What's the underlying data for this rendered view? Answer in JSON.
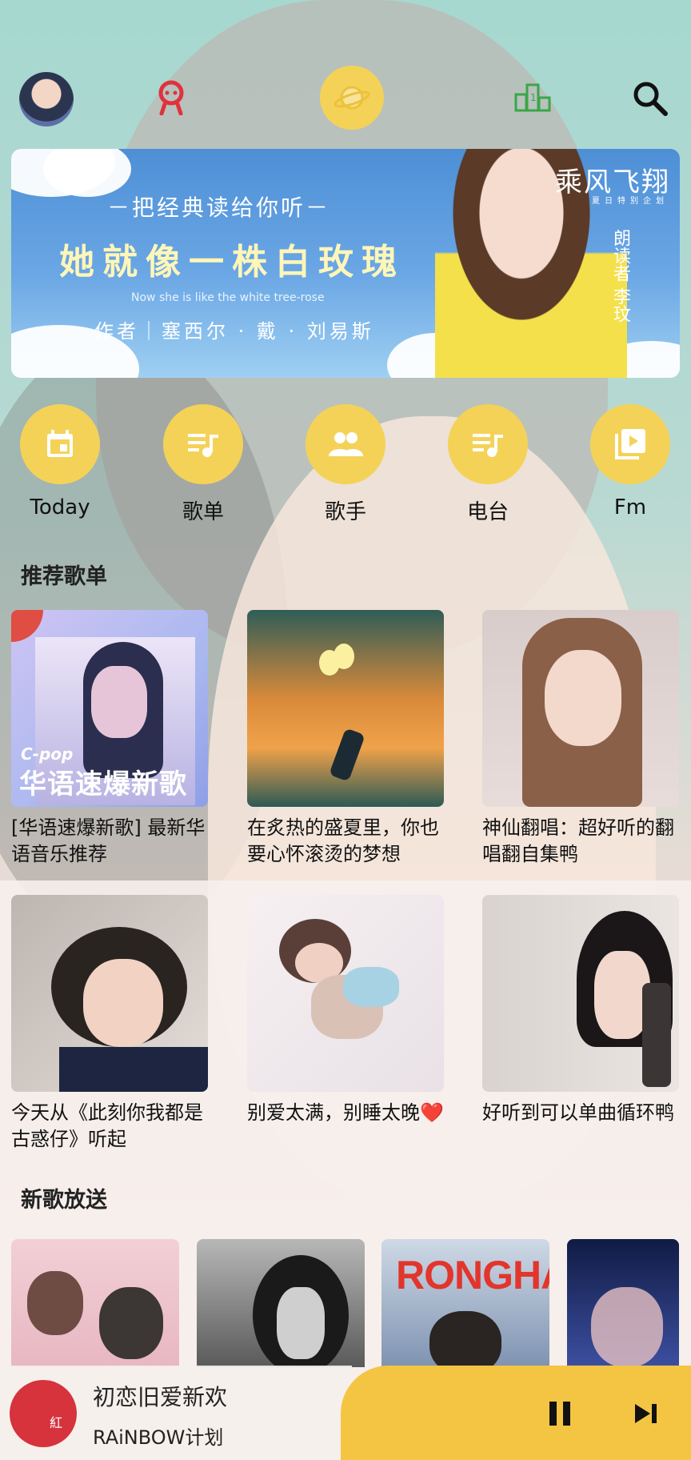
{
  "top_nav": {
    "items": [
      {
        "name": "avatar"
      },
      {
        "name": "mine-icon"
      },
      {
        "name": "discover-planet-icon",
        "active": true
      },
      {
        "name": "rank-icon"
      },
      {
        "name": "search-icon"
      }
    ],
    "accent": "#f4d257"
  },
  "banner": {
    "tagline": "－把经典读给你听－",
    "headline": "她就像一株白玫瑰",
    "english": "Now she is like the white tree-rose",
    "author": "作者｜塞西尔 · 戴 · 刘易斯",
    "brand": "乘风飞翔",
    "brand_sub": "夏日特别企划",
    "readers": "朗读者 李玟"
  },
  "quick_entries": [
    {
      "label": "Today",
      "icon": "calendar-icon"
    },
    {
      "label": "歌单",
      "icon": "playlist-icon"
    },
    {
      "label": "歌手",
      "icon": "people-icon"
    },
    {
      "label": "电台",
      "icon": "playlist-icon"
    },
    {
      "label": "Fm",
      "icon": "video-library-icon"
    }
  ],
  "recommended": {
    "title": "推荐歌单",
    "playlists": [
      {
        "title": "[华语速爆新歌] 最新华语音乐推荐",
        "cover_text_1": "C-pop",
        "cover_text_2": "华语速爆新歌"
      },
      {
        "title": "在炙热的盛夏里，你也要心怀滚烫的梦想"
      },
      {
        "title": "神仙翻唱：超好听的翻唱翻自集鸭"
      },
      {
        "title": "今天从《此刻你我都是古惑仔》听起"
      },
      {
        "title": "别爱太满，别睡太晚❤️"
      },
      {
        "title": "好听到可以单曲循环鸭"
      }
    ]
  },
  "new_songs": {
    "title": "新歌放送",
    "albums": [
      {
        "cover_text": ""
      },
      {
        "cover_text": ""
      },
      {
        "cover_text": "RONGHAO"
      },
      {
        "cover_text": ""
      }
    ]
  },
  "player": {
    "song": "初恋旧爱新欢",
    "artist": "RAiNBOW计划",
    "disc_mark": "紅"
  }
}
